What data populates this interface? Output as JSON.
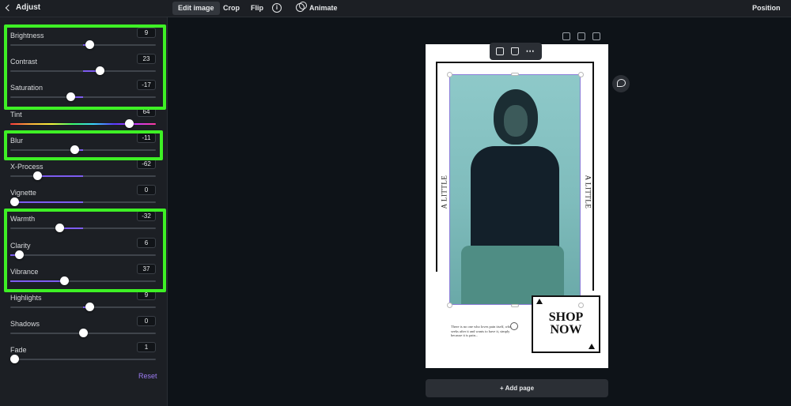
{
  "header": {
    "back_label": "Adjust",
    "tabs": [
      "Edit image",
      "Crop",
      "Flip"
    ],
    "animate_label": "Animate",
    "position_label": "Position",
    "info_icon_glyph": "i"
  },
  "adjustments": [
    {
      "label": "Brightness",
      "value": "9",
      "level": 0.545
    },
    {
      "label": "Contrast",
      "value": "23",
      "level": 0.615
    },
    {
      "label": "Saturation",
      "value": "-17",
      "level": 0.415
    },
    {
      "label": "Tint",
      "value": "64",
      "level": 0.82
    },
    {
      "label": "Blur",
      "value": "-11",
      "level": 0.445
    },
    {
      "label": "X-Process",
      "value": "-62",
      "level": 0.19
    },
    {
      "label": "Vignette",
      "value": "0",
      "level": 0.0
    },
    {
      "label": "Warmth",
      "value": "-32",
      "level": 0.34
    },
    {
      "label": "Clarity",
      "value": "6",
      "level": 0.06
    },
    {
      "label": "Vibrance",
      "value": "37",
      "level": 0.37
    },
    {
      "label": "Highlights",
      "value": "9",
      "level": 0.545
    },
    {
      "label": "Shadows",
      "value": "0",
      "level": 0.5
    },
    {
      "label": "Fade",
      "value": "1",
      "level": 0.01
    }
  ],
  "reset_label": "Reset",
  "design": {
    "vertical_text_left": "A LITTLE",
    "vertical_text_right": "A LITTLE",
    "shop_line1": "SHOP",
    "shop_line2": "NOW",
    "small_text": "There is no one who loves pain itself, who seeks after it and wants to have it, simply because it is pain..."
  },
  "add_page_label": "+ Add page",
  "colors": {
    "accent": "#7d5cf0",
    "highlight": "#3ef025",
    "panel_bg": "#1c1f24",
    "canvas_bg": "#0e1318"
  }
}
